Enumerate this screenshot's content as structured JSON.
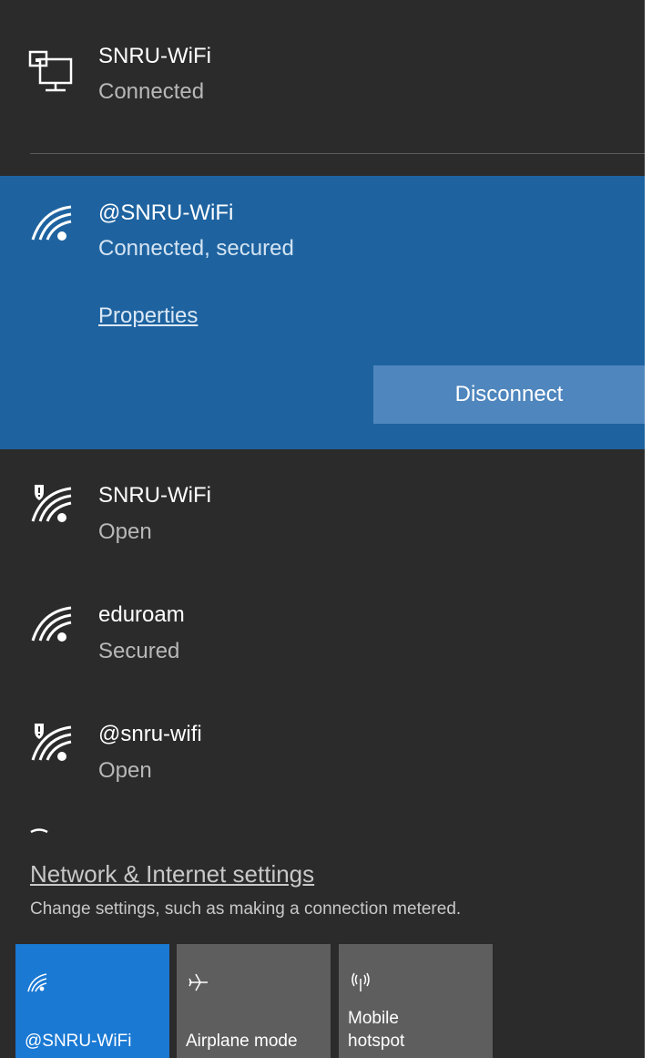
{
  "ethernet": {
    "name": "SNRU-WiFi",
    "status": "Connected",
    "icon": "ethernet-icon"
  },
  "connected_network": {
    "name": "@SNRU-WiFi",
    "status": "Connected, secured",
    "properties_label": "Properties",
    "disconnect_label": "Disconnect",
    "icon": "wifi-signal-icon"
  },
  "networks": [
    {
      "name": "SNRU-WiFi",
      "status": "Open",
      "icon": "wifi-open-warning-icon"
    },
    {
      "name": "eduroam",
      "status": "Secured",
      "icon": "wifi-signal-icon"
    },
    {
      "name": "@snru-wifi",
      "status": "Open",
      "icon": "wifi-open-warning-icon"
    }
  ],
  "settings": {
    "link_label": "Network & Internet settings",
    "description": "Change settings, such as making a connection metered."
  },
  "quick_actions": [
    {
      "label": "@SNRU-WiFi",
      "icon": "wifi-icon",
      "active": true
    },
    {
      "label": "Airplane mode",
      "icon": "airplane-icon",
      "active": false
    },
    {
      "label_line1": "Mobile",
      "label_line2": "hotspot",
      "icon": "mobile-hotspot-icon",
      "active": false
    }
  ],
  "colors": {
    "panel_bg": "#2b2b2b",
    "selected_bg": "#1e63a0",
    "button_bg": "#4f86bd",
    "tile_active": "#1a79d3",
    "tile_inactive": "#5e5e5e"
  }
}
